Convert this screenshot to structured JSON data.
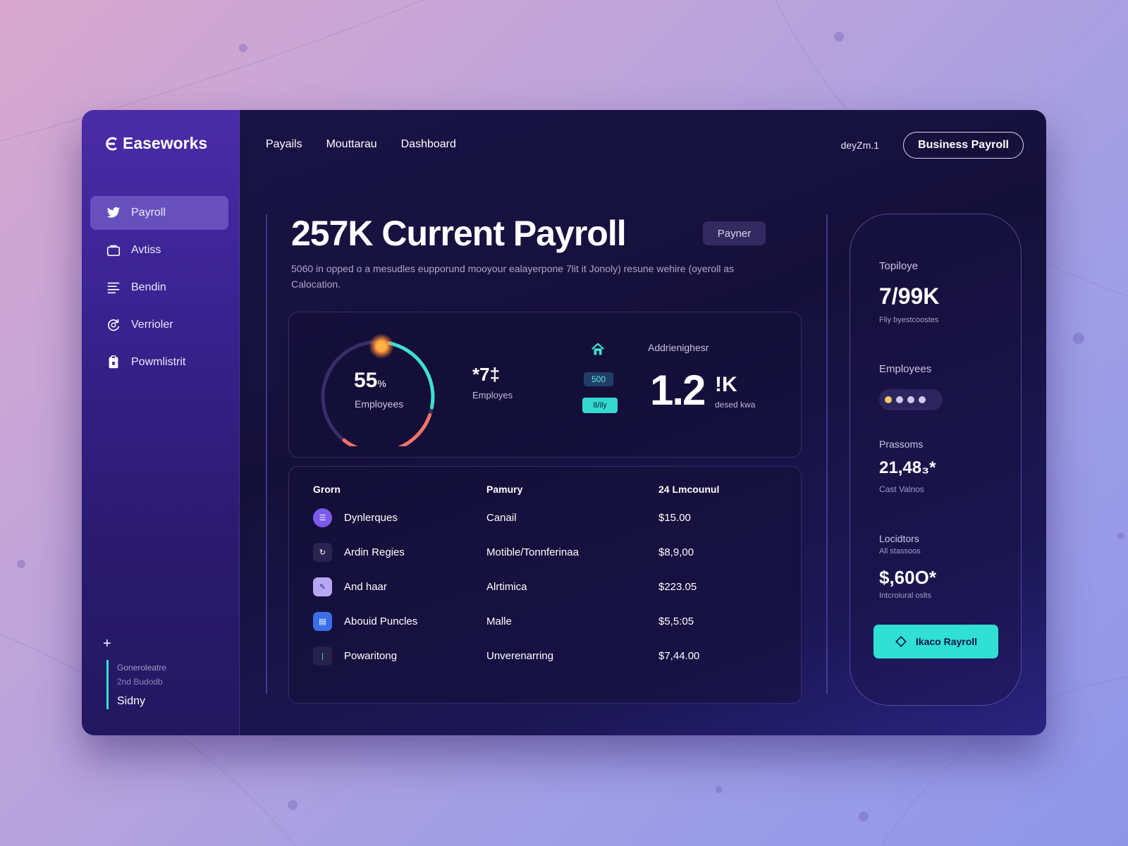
{
  "app": {
    "logo_text": "Easeworks"
  },
  "sidebar": {
    "items": [
      {
        "label": "Payroll",
        "icon": "bird-icon",
        "active": true
      },
      {
        "label": "Avtiss",
        "icon": "bag-icon"
      },
      {
        "label": "Bendin",
        "icon": "list-icon"
      },
      {
        "label": "Verrioler",
        "icon": "refresh-icon"
      },
      {
        "label": "Powmlistrit",
        "icon": "clipboard-icon"
      }
    ],
    "plus": "+",
    "footer": {
      "line1": "Goneroleatre",
      "line2": "2nd Budodb",
      "line3": "Sidny"
    }
  },
  "topnav": {
    "items": [
      "Payails",
      "Mouttarau",
      "Dashboard"
    ]
  },
  "header": {
    "user_label": "deyZm.1",
    "business_button": "Business Payroll"
  },
  "main": {
    "title": "257K Current Payroll",
    "tag": "Payner",
    "description": "5060 in opped o a mesudles eupporund mooyour ealayerpone 7lit it Jonoly) resune wehire (oyeroll as Calocation."
  },
  "stats": {
    "ring_value": "55",
    "ring_unit": "%",
    "ring_label": "Employees",
    "ring_percent": 55,
    "employees_value": "*7‡",
    "employees_label": "Employes",
    "chip_a": "500",
    "chip_b": "8/ily",
    "additional_label": "Addrienighesr",
    "big_value": "1.2",
    "big_unit": "!K",
    "big_sub": "desed kwa"
  },
  "table": {
    "headers": [
      "Grorn",
      "Pamury",
      "24 Lmcounul"
    ],
    "rows": [
      {
        "name": "Dynlerques",
        "type": "Canail",
        "amount": "$15.00",
        "icon_color": "#7b5bea"
      },
      {
        "name": "Ardin Regies",
        "type": "Motible/Tonnferinaa",
        "amount": "$8,9,00",
        "icon_color": "#2a2550"
      },
      {
        "name": "And haar",
        "type": "Alrtimica",
        "amount": "$223.05",
        "icon_color": "#b9a7f2"
      },
      {
        "name": "Abouid Puncles",
        "type": "Malle",
        "amount": "$5,5:05",
        "icon_color": "#3b6ee8"
      },
      {
        "name": "Powaritong",
        "type": "Unverenarring",
        "amount": "$7,44.00",
        "icon_color": "#26224a"
      }
    ]
  },
  "right_panel": {
    "top_label": "Topiloye",
    "top_value": "7/99K",
    "top_sub": "Fliy byestcoostes",
    "employees_label": "Employees",
    "persons_label": "Prassoms",
    "persons_value": "21,48₃*",
    "persons_sub": "Cast Valnos",
    "locations_label": "Locidtors",
    "locations_sub": "All stassoos",
    "locations_value": "$,60O*",
    "locations_sub2": "Intcroiural oslts",
    "button": "Ikaco Rayroll"
  },
  "colors": {
    "accent_teal": "#2fe0d3",
    "ring_teal": "#3ee0d2",
    "ring_coral": "#f0736a",
    "sidebar_purple": "#3a2392"
  }
}
